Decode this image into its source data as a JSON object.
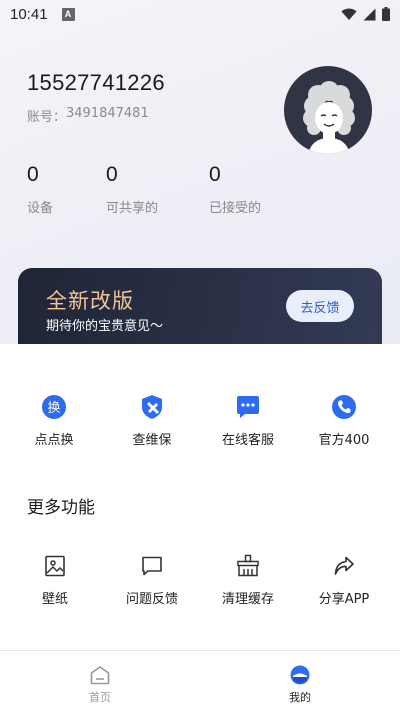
{
  "status_bar": {
    "time": "10:41",
    "notification_icon": "a-badge-icon",
    "wifi_icon": "wifi-icon",
    "signal_icon": "signal-icon",
    "battery_icon": "battery-icon"
  },
  "profile": {
    "phone": "15527741226",
    "account_label": "账号：",
    "account_id": "3491847481",
    "avatar_icon": "avatar-cartoon-icon"
  },
  "stats": [
    {
      "value": "0",
      "label": "设备"
    },
    {
      "value": "0",
      "label": "可共享的"
    },
    {
      "value": "0",
      "label": "已接受的"
    }
  ],
  "banner": {
    "title": "全新改版",
    "subtitle": "期待你的宝贵意见～",
    "button": "去反馈"
  },
  "services": [
    {
      "label": "点点换",
      "icon": "exchange-icon",
      "glyph": "换"
    },
    {
      "label": "查维保",
      "icon": "wrench-shield-icon"
    },
    {
      "label": "在线客服",
      "icon": "chat-bubble-icon"
    },
    {
      "label": "官方400",
      "icon": "phone-icon"
    }
  ],
  "more_section_title": "更多功能",
  "more": [
    {
      "label": "壁纸",
      "icon": "image-icon"
    },
    {
      "label": "问题反馈",
      "icon": "message-icon"
    },
    {
      "label": "清理缓存",
      "icon": "clean-icon"
    },
    {
      "label": "分享APP",
      "icon": "share-icon"
    }
  ],
  "nav": {
    "home": "首页",
    "mine": "我的"
  },
  "colors": {
    "accent": "#2d6cf0",
    "banner_title": "#f0c59a",
    "banner_bg": "#252c40"
  }
}
